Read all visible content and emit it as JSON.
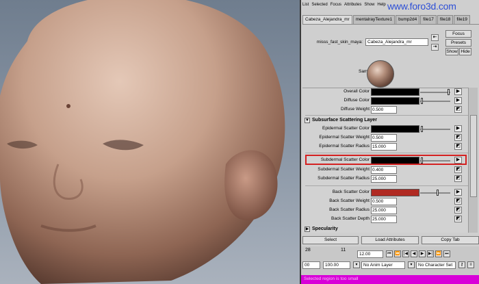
{
  "watermark": "www.foro3d.com",
  "menubar": [
    "List",
    "Selected",
    "Focus",
    "Attributes",
    "Show",
    "Help"
  ],
  "tabs": [
    "Cabeza_Alejandra_mr",
    "mentalrayTexture1",
    "bump2d4",
    "file17",
    "file18",
    "file19"
  ],
  "node": {
    "type_label": "misss_fast_skin_maya:",
    "name_value": "Cabeza_Alejandra_mr",
    "buttons": {
      "focus": "Focus",
      "presets": "Presets",
      "show": "Show",
      "hide": "Hide"
    }
  },
  "sample_label": "Sample",
  "colors": {
    "overall": "#000000",
    "diffuse": "#000000",
    "epidermal": "#000000",
    "subdermal": "#000000",
    "back": "#b02a22",
    "highlight": "#d42020",
    "status_bg": "#d800d8"
  },
  "attributes": {
    "overall_color": "Overall Color",
    "diffuse_color": "Diffuse Color",
    "diffuse_weight": {
      "label": "Diffuse Weight",
      "value": "0.500"
    },
    "sss_layer_title": "Subsurface Scattering Layer",
    "epidermal_color": "Epidermal Scatter Color",
    "epidermal_weight": {
      "label": "Epidermal Scatter Weight",
      "value": "0.500"
    },
    "epidermal_radius": {
      "label": "Epidermal Scatter Radius",
      "value": "15.000"
    },
    "subdermal_color": "Subdermal Scatter Color",
    "subdermal_weight": {
      "label": "Subdermal Scatter Weight",
      "value": "0.400"
    },
    "subdermal_radius": {
      "label": "Subdermal Scatter Radius",
      "value": "25.000"
    },
    "back_color": "Back Scatter Color",
    "back_weight": {
      "label": "Back Scatter Weight",
      "value": "0.500"
    },
    "back_radius": {
      "label": "Back Scatter Radius",
      "value": "25.000"
    },
    "back_depth": {
      "label": "Back Scatter Depth",
      "value": "25.000"
    },
    "specularity_title": "Specularity"
  },
  "bottom_buttons": {
    "select": "Select",
    "load": "Load Attributes",
    "copy": "Copy Tab"
  },
  "timeline": {
    "tick_a": "28",
    "tick_b": "11",
    "current_frame": "12.00",
    "start": "00",
    "end": "100.00",
    "anim_layer": "No Anim Layer",
    "character_set": "No Character Set"
  },
  "status_text": "Selected region is too small"
}
